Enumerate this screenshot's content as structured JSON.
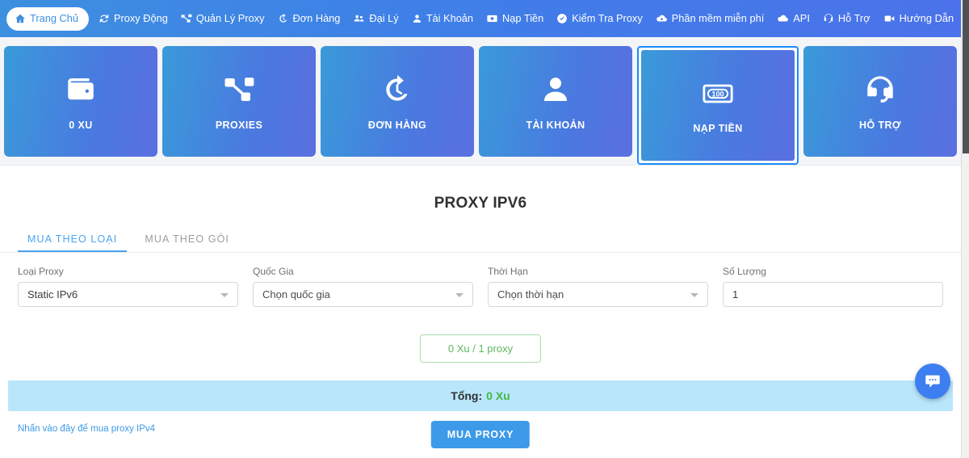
{
  "navbar": {
    "items": [
      {
        "label": "Trang Chủ",
        "icon": "home-icon",
        "active": true
      },
      {
        "label": "Proxy Động",
        "icon": "refresh-icon",
        "active": false
      },
      {
        "label": "Quản Lý Proxy",
        "icon": "sitemap-icon",
        "active": false
      },
      {
        "label": "Đơn Hàng",
        "icon": "history-icon",
        "active": false
      },
      {
        "label": "Đại Lý",
        "icon": "users-icon",
        "active": false
      },
      {
        "label": "Tài Khoản",
        "icon": "user-icon",
        "active": false
      },
      {
        "label": "Nạp Tiền",
        "icon": "money-icon",
        "active": false
      },
      {
        "label": "Kiểm Tra Proxy",
        "icon": "check-circle-icon",
        "active": false
      },
      {
        "label": "Phần mềm miễn phí",
        "icon": "cloud-download-icon",
        "active": false
      },
      {
        "label": "API",
        "icon": "cloud-icon",
        "active": false
      },
      {
        "label": "Hỗ Trợ",
        "icon": "headset-icon",
        "active": false
      },
      {
        "label": "Hướng Dẫn",
        "icon": "video-icon",
        "active": false
      }
    ]
  },
  "tiles": [
    {
      "label": "0 XU",
      "icon": "wallet-icon",
      "selected": false
    },
    {
      "label": "PROXIES",
      "icon": "sitemap-icon",
      "selected": false
    },
    {
      "label": "ĐƠN HÀNG",
      "icon": "history-icon",
      "selected": false
    },
    {
      "label": "TÀI KHOẢN",
      "icon": "user-icon",
      "selected": false
    },
    {
      "label": "NẠP TIỀN",
      "icon": "banknote-100-icon",
      "selected": true
    },
    {
      "label": "HỖ TRỢ",
      "icon": "headset-icon",
      "selected": false
    }
  ],
  "main": {
    "title": "PROXY IPV6",
    "tabs": [
      {
        "label": "MUA THEO LOẠI",
        "active": true
      },
      {
        "label": "MUA THEO GÓI",
        "active": false
      }
    ],
    "fields": [
      {
        "label": "Loại Proxy",
        "value": "Static IPv6",
        "type": "select"
      },
      {
        "label": "Quốc Gia",
        "value": "Chọn quốc gia",
        "type": "select"
      },
      {
        "label": "Thời Hạn",
        "value": "Chọn thời hạn",
        "type": "select"
      },
      {
        "label": "Số Lượng",
        "value": "1",
        "type": "input"
      }
    ],
    "price_badge": "0 Xu / 1 proxy",
    "total_label": "Tổng:",
    "total_value": "0 Xu",
    "ipv4_link": "Nhấn vào đây để mua proxy IPv4",
    "buy_button": "MUA PROXY"
  },
  "chat": {
    "icon": "chat-bubble-icon"
  },
  "colors": {
    "nav_start": "#3d8fe0",
    "nav_end": "#4b72ea",
    "accent_blue": "#3d9ae8",
    "selection_border": "#1a8cff",
    "total_bar_bg": "#b9e6fb",
    "green": "#45b649",
    "badge_border": "#a8dcab"
  }
}
